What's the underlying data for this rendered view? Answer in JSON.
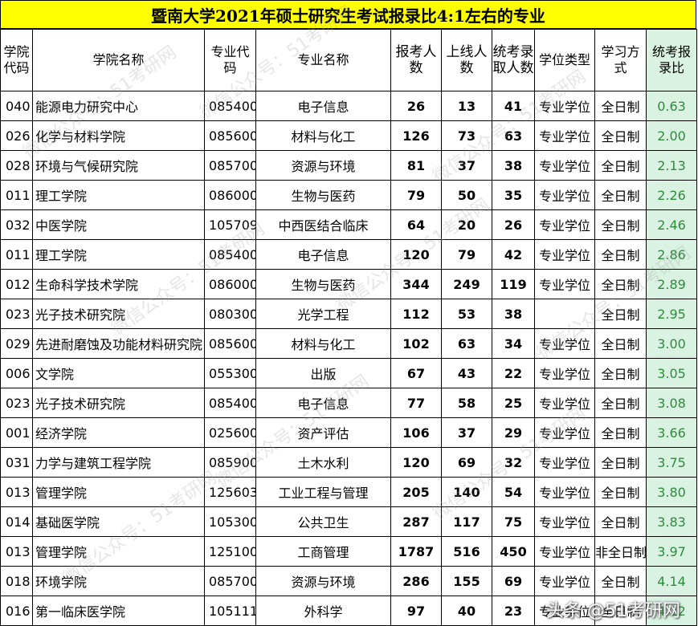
{
  "title": "暨南大学2021年硕士研究生考试报录比4:1左右的专业",
  "headers": {
    "college_code": "学院代码",
    "college_name": "学院名称",
    "major_code": "专业代码",
    "major_name": "专业名称",
    "applicants": "报考人数",
    "passed": "上线人数",
    "admitted": "统考录取人数",
    "degree_type": "学位类型",
    "study_mode": "学习方式",
    "ratio": "统考报录比"
  },
  "rows": [
    {
      "code": "040",
      "college": "能源电力研究中心",
      "mcode": "085400",
      "major": "电子信息",
      "apply": "26",
      "pass": "13",
      "admit": "41",
      "degree": "专业学位",
      "mode": "全日制",
      "ratio": "0.63"
    },
    {
      "code": "026",
      "college": "化学与材料学院",
      "mcode": "085600",
      "major": "材料与化工",
      "apply": "126",
      "pass": "73",
      "admit": "63",
      "degree": "专业学位",
      "mode": "全日制",
      "ratio": "2.00"
    },
    {
      "code": "028",
      "college": "环境与气候研究院",
      "mcode": "085700",
      "major": "资源与环境",
      "apply": "81",
      "pass": "37",
      "admit": "38",
      "degree": "专业学位",
      "mode": "全日制",
      "ratio": "2.13"
    },
    {
      "code": "011",
      "college": "理工学院",
      "mcode": "086000",
      "major": "生物与医药",
      "apply": "79",
      "pass": "50",
      "admit": "35",
      "degree": "专业学位",
      "mode": "全日制",
      "ratio": "2.26"
    },
    {
      "code": "032",
      "college": "中医学院",
      "mcode": "105709",
      "major": "中西医结合临床",
      "apply": "64",
      "pass": "20",
      "admit": "26",
      "degree": "专业学位",
      "mode": "全日制",
      "ratio": "2.46"
    },
    {
      "code": "011",
      "college": "理工学院",
      "mcode": "085400",
      "major": "电子信息",
      "apply": "120",
      "pass": "79",
      "admit": "42",
      "degree": "专业学位",
      "mode": "全日制",
      "ratio": "2.86"
    },
    {
      "code": "012",
      "college": "生命科学技术学院",
      "mcode": "086000",
      "major": "生物与医药",
      "apply": "344",
      "pass": "249",
      "admit": "119",
      "degree": "专业学位",
      "mode": "全日制",
      "ratio": "2.89"
    },
    {
      "code": "023",
      "college": "光子技术研究院",
      "mcode": "080300",
      "major": "光学工程",
      "apply": "112",
      "pass": "53",
      "admit": "38",
      "degree": "",
      "mode": "全日制",
      "ratio": "2.95"
    },
    {
      "code": "029",
      "college": "先进耐磨蚀及功能材料研究院",
      "mcode": "085600",
      "major": "材料与化工",
      "apply": "102",
      "pass": "63",
      "admit": "34",
      "degree": "专业学位",
      "mode": "全日制",
      "ratio": "3.00"
    },
    {
      "code": "006",
      "college": "文学院",
      "mcode": "055300",
      "major": "出版",
      "apply": "67",
      "pass": "43",
      "admit": "22",
      "degree": "专业学位",
      "mode": "全日制",
      "ratio": "3.05"
    },
    {
      "code": "023",
      "college": "光子技术研究院",
      "mcode": "085400",
      "major": "电子信息",
      "apply": "77",
      "pass": "58",
      "admit": "25",
      "degree": "专业学位",
      "mode": "全日制",
      "ratio": "3.08"
    },
    {
      "code": "001",
      "college": "经济学院",
      "mcode": "025600",
      "major": "资产评估",
      "apply": "106",
      "pass": "37",
      "admit": "29",
      "degree": "专业学位",
      "mode": "全日制",
      "ratio": "3.66"
    },
    {
      "code": "031",
      "college": "力学与建筑工程学院",
      "mcode": "085900",
      "major": "土木水利",
      "apply": "120",
      "pass": "69",
      "admit": "32",
      "degree": "专业学位",
      "mode": "全日制",
      "ratio": "3.75"
    },
    {
      "code": "013",
      "college": "管理学院",
      "mcode": "125603",
      "major": "工业工程与管理",
      "apply": "205",
      "pass": "140",
      "admit": "54",
      "degree": "专业学位",
      "mode": "全日制",
      "ratio": "3.80"
    },
    {
      "code": "014",
      "college": "基础医学院",
      "mcode": "105300",
      "major": "公共卫生",
      "apply": "287",
      "pass": "117",
      "admit": "75",
      "degree": "专业学位",
      "mode": "全日制",
      "ratio": "3.83"
    },
    {
      "code": "013",
      "college": "管理学院",
      "mcode": "125100",
      "major": "工商管理",
      "apply": "1787",
      "pass": "516",
      "admit": "450",
      "degree": "专业学位",
      "mode": "非全日制",
      "ratio": "3.97"
    },
    {
      "code": "018",
      "college": "环境学院",
      "mcode": "085700",
      "major": "资源与环境",
      "apply": "286",
      "pass": "155",
      "admit": "69",
      "degree": "专业学位",
      "mode": "全日制",
      "ratio": "4.14"
    },
    {
      "code": "016",
      "college": "第一临床医学院",
      "mcode": "105111",
      "major": "外科学",
      "apply": "97",
      "pass": "40",
      "admit": "23",
      "degree": "专业学位",
      "mode": "全日制",
      "ratio": "4.22"
    }
  ],
  "watermark_text": "微信公众号：51考研网",
  "brand": "头条 @51考研网"
}
